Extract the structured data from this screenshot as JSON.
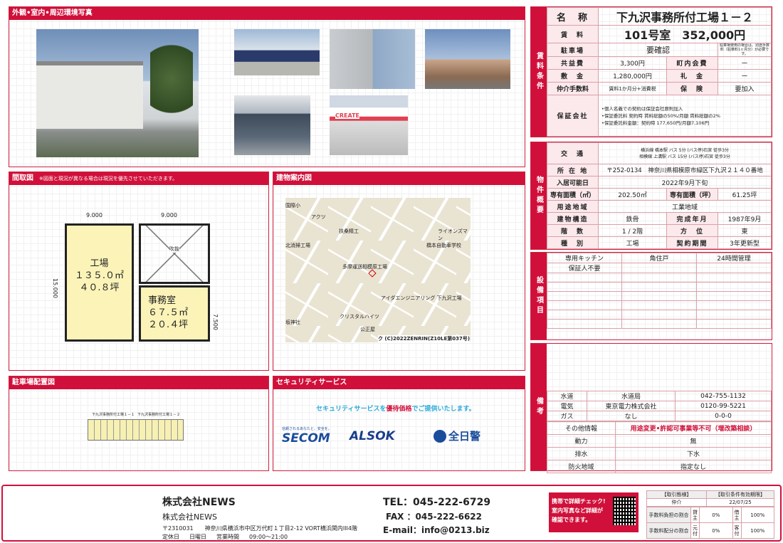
{
  "photos_section": {
    "title": "外観•室内•周辺環境写真"
  },
  "floor_section": {
    "title": "間取図",
    "note": "※図面と現況が異なる場合は現況を優先させていただきます。",
    "dims": {
      "top_left": "9.000",
      "top_right": "9.000",
      "left": "15.000",
      "right": "7.500"
    },
    "factory": {
      "name": "工場",
      "area_m": "１３５.０㎡",
      "area_tsubo": "４０.８坪"
    },
    "office": {
      "name": "事務室",
      "area_m": "６７.５㎡",
      "area_tsubo": "２０.４坪"
    },
    "void": "吹抜"
  },
  "map_section": {
    "title": "建物案内図",
    "labels": [
      "国際小",
      "アクツ",
      "扶桑精工",
      "北消掃工場",
      "ライオンズマン",
      "橋本自動車学校",
      "多摩運送相模原工場",
      "アイダエンジニアリング 下九沢工場",
      "クリスタルハイツ",
      "坂神社",
      "公正屋"
    ],
    "copyright": "ク (C)2022ZENRIN(Z10LE第037号)"
  },
  "parking_section": {
    "title": "駐車場配置図",
    "labels": [
      "下九沢事務所付工場１－１",
      "下九沢事務所付工場１－２"
    ]
  },
  "security_section": {
    "title": "セキュリティサービス",
    "tagline_pre": "セキュリティサービスを",
    "tagline_em": "優待価格",
    "tagline_post": "でご提供いたします。",
    "secom_small": "信頼されるあなたと、安全を。",
    "secom": "SECOM",
    "alsok": "ALSOK",
    "zennikkei": "全日警"
  },
  "rent": {
    "side": "賃料条件",
    "name_label": "名　称",
    "name": "下九沢事務所付工場１－２",
    "rent_label": "賃　料",
    "room": "101号室",
    "rent": "352,000円",
    "parking_label": "駐車場",
    "parking": "要確認",
    "parking_note": "駐車場使用の場合は、別途手数料（駐車料1ヶ月分）が必要です。",
    "common_label": "共益費",
    "common": "3,300円",
    "town_label": "町内会費",
    "town": "ー",
    "deposit_label": "敷　金",
    "deposit": "1,280,000円",
    "key_label": "礼　金",
    "key": "ー",
    "fee_label": "仲介手数料",
    "fee": "賃料1か月分+消費税",
    "ins_label": "保　険",
    "ins": "要加入",
    "guar_label": "保証会社",
    "guar": [
      "•個人名義での契約は保証会社原則加入",
      "•保証委託料 契約時 賃料総額の50%/月額 賃料総額の2%",
      "•保証委託料金額：契約時 177,650円/月額7,106円"
    ]
  },
  "property": {
    "side": "物件概要",
    "access_label": "交　通",
    "access": [
      "横浜線 橋本駅 バス 5分 (バス停)石宮 徒歩3分",
      "相模線 上溝駅 バス 15分 (バス停)石宮 徒歩3分"
    ],
    "addr_label": "所 在 地",
    "addr": "〒252-0134　神奈川県相模原市緑区下九沢２１４０番地",
    "avail_label": "入居可能日",
    "avail": "2022年9月下旬",
    "area_m_label": "専有面積（㎡）",
    "area_m": "202.50㎡",
    "area_t_label": "専有面積（坪）",
    "area_t": "61.25坪",
    "zone_label": "用途地域",
    "zone": "工業地域",
    "struct_label": "建物構造",
    "struct": "鉄骨",
    "built_label": "完成年月",
    "built": "1987年9月",
    "floor_label": "階　数",
    "floor": "1 / 2階",
    "dir_label": "方　位",
    "dir": "東",
    "type_label": "種　別",
    "type": "工場",
    "contract_label": "契約期間",
    "contract": "3年更新型"
  },
  "equipment": {
    "side": "設備項目",
    "items": [
      "専用キッチン",
      "角住戸",
      "24時間管理",
      "保証人不要"
    ]
  },
  "remarks": {
    "side": "備考",
    "util": [
      [
        "水道",
        "水道局",
        "042-755-1132"
      ],
      [
        "電気",
        "東京電力株式会社",
        "0120-99-5221"
      ],
      [
        "ガス",
        "なし",
        "0-0-0"
      ]
    ],
    "other_label": "その他情報",
    "other": "用途変更•許認可事業等不可（増改築相談）",
    "power_label": "動力",
    "power": "無",
    "drain_label": "排水",
    "drain": "下水",
    "fire_label": "防火地域",
    "fire": "指定なし"
  },
  "footer": {
    "company": "株式会社NEWS",
    "company2": "株式会社NEWS",
    "address": "〒2310031　　神奈川県横浜市中区万代町１丁目2-12 VORT横浜関内III4階",
    "holiday_label": "定休日",
    "holiday": "日曜日",
    "hours_label": "営業時間",
    "hours": "09:00～21:00",
    "tel": "TEL：045-222-6729",
    "fax": "FAX ：045-222-6622",
    "email": "E-mail：info@0213.biz",
    "qr_text": [
      "携帯で詳細チェック!",
      "室内写真など詳細が",
      "確認できます。"
    ],
    "mode_label": "【取引態様】",
    "mode": "仲介",
    "valid_label": "【取引条件有効期限】",
    "valid": "22/07/25",
    "fee_burden_label": "手数料負担の割合",
    "fee_split_label": "手数料配分の割合",
    "lessor": "貸主",
    "lessee": "借主",
    "moto": "元付",
    "kyaku": "客付",
    "b1": "0%",
    "b2": "100%",
    "s1": "0%",
    "s2": "100%"
  },
  "colors": {
    "accent": "#d0103a"
  }
}
